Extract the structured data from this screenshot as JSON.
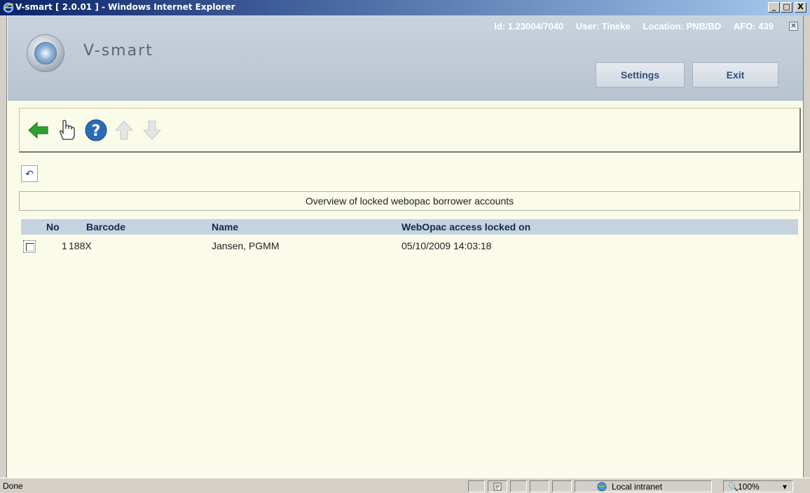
{
  "window": {
    "title": "V-smart [ 2.0.01 ] - Windows Internet Explorer",
    "buttons": {
      "minimize": "_",
      "maximize": "□",
      "close": "X"
    }
  },
  "header": {
    "logo_text": "V-smart",
    "id_label": "Id: 1.23004/7040",
    "user_label": "User: Tineke",
    "location_label": "Location: PNB/BD",
    "afo_label": "AFO: 439",
    "settings_label": "Settings",
    "exit_label": "Exit",
    "close_glyph": "✕"
  },
  "toolbar": {
    "icons": [
      "back-arrow-icon",
      "hand-pointer-icon",
      "help-icon",
      "arrow-up-icon",
      "arrow-down-icon"
    ]
  },
  "undo_glyph": "↶",
  "caption": "Overview of locked webopac borrower accounts",
  "table": {
    "columns": {
      "no": "No",
      "barcode": "Barcode",
      "name": "Name",
      "locked_on": "WebOpac access locked on"
    },
    "rows": [
      {
        "no": "1",
        "barcode": "188X",
        "name": "Jansen, PGMM",
        "locked_on": "05/10/2009 14:03:18"
      }
    ]
  },
  "statusbar": {
    "status": "Done",
    "zone": "Local intranet",
    "zoom": "100%"
  },
  "colors": {
    "title_bar": "#0a246a",
    "header_bg": "#c9d3dd",
    "page_bg": "#fbfbe9",
    "table_header_bg": "#c5d3e0",
    "back_arrow": "#2fa12f",
    "help_icon": "#2a6bb5"
  }
}
